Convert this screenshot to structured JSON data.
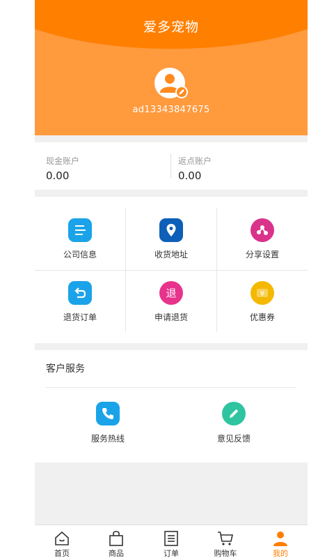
{
  "header": {
    "title": "爱多宠物",
    "username": "ad13343847675"
  },
  "accounts": [
    {
      "label": "现金账户",
      "value": "0.00"
    },
    {
      "label": "返点账户",
      "value": "0.00"
    }
  ],
  "menu": [
    {
      "label": "公司信息",
      "icon": "document-icon",
      "color": "#1aa3e8"
    },
    {
      "label": "收货地址",
      "icon": "location-pin-icon",
      "color": "#0d5fb8"
    },
    {
      "label": "分享设置",
      "icon": "share-icon",
      "color": "#d9338c"
    },
    {
      "label": "退货订单",
      "icon": "return-arrow-icon",
      "color": "#1aa3e8"
    },
    {
      "label": "申请退货",
      "icon": "return-badge-icon",
      "glyph": "退",
      "color": "#e8338c"
    },
    {
      "label": "优惠券",
      "icon": "coupon-icon",
      "glyph": "¥",
      "color": "#f5b800"
    }
  ],
  "service": {
    "title": "客户服务",
    "items": [
      {
        "label": "服务热线",
        "icon": "phone-icon",
        "color": "#1aa3e8"
      },
      {
        "label": "意见反馈",
        "icon": "pencil-icon",
        "color": "#2ec4a0"
      }
    ]
  },
  "tabs": [
    {
      "label": "首页",
      "icon": "home-icon",
      "active": false
    },
    {
      "label": "商品",
      "icon": "bag-icon",
      "active": false
    },
    {
      "label": "订单",
      "icon": "order-list-icon",
      "active": false
    },
    {
      "label": "购物车",
      "icon": "cart-icon",
      "active": false
    },
    {
      "label": "我的",
      "icon": "user-icon",
      "active": true
    }
  ],
  "colors": {
    "brand": "#ff7f00",
    "header_bg": "#ff9a3d",
    "page_bg": "#f0f0f0"
  }
}
